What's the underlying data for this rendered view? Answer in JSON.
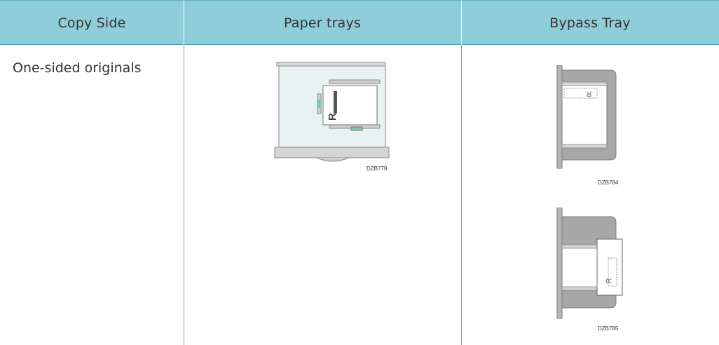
{
  "table": {
    "headers": [
      "Copy Side",
      "Paper trays",
      "Bypass Tray"
    ],
    "rows": [
      {
        "label": "One-sided originals",
        "paper_tray_figure": {
          "code": "DZB779",
          "icon": "paper-tray-loading-icon"
        },
        "bypass_tray_figures": [
          {
            "code": "DZB784",
            "icon": "bypass-tray-loading-icon"
          },
          {
            "code": "DZB785",
            "icon": "bypass-tray-loading-rotated-icon"
          }
        ]
      }
    ]
  },
  "colors": {
    "header_bg": "#8fcdd8",
    "tray_gray": "#9a9a9a",
    "tray_fill": "#e6f1f1",
    "accent_green": "#79c9a6"
  }
}
